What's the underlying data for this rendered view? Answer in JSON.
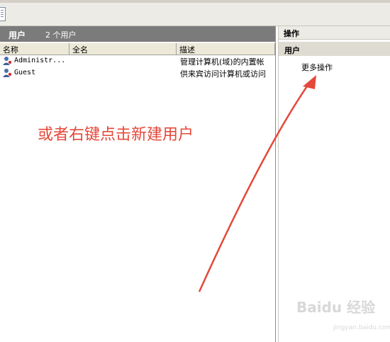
{
  "list": {
    "title": "用户",
    "count": "2 个用户",
    "columns": [
      "名称",
      "全名",
      "描述"
    ],
    "rows": [
      {
        "name": "Administr...",
        "fullname": "",
        "desc": "管理计算机(域)的内置帐",
        "icon": "user-icon"
      },
      {
        "name": "Guest",
        "fullname": "",
        "desc": "供来宾访问计算机或访问",
        "icon": "user-icon"
      }
    ]
  },
  "actions": {
    "header": "操作",
    "section": "用户",
    "more": "更多操作"
  },
  "annotation": {
    "text": "或者右键点击新建用户",
    "color": "#e5483a"
  },
  "watermark": {
    "text": "Baidu 经验",
    "sub": "jingyan.baidu.com"
  }
}
